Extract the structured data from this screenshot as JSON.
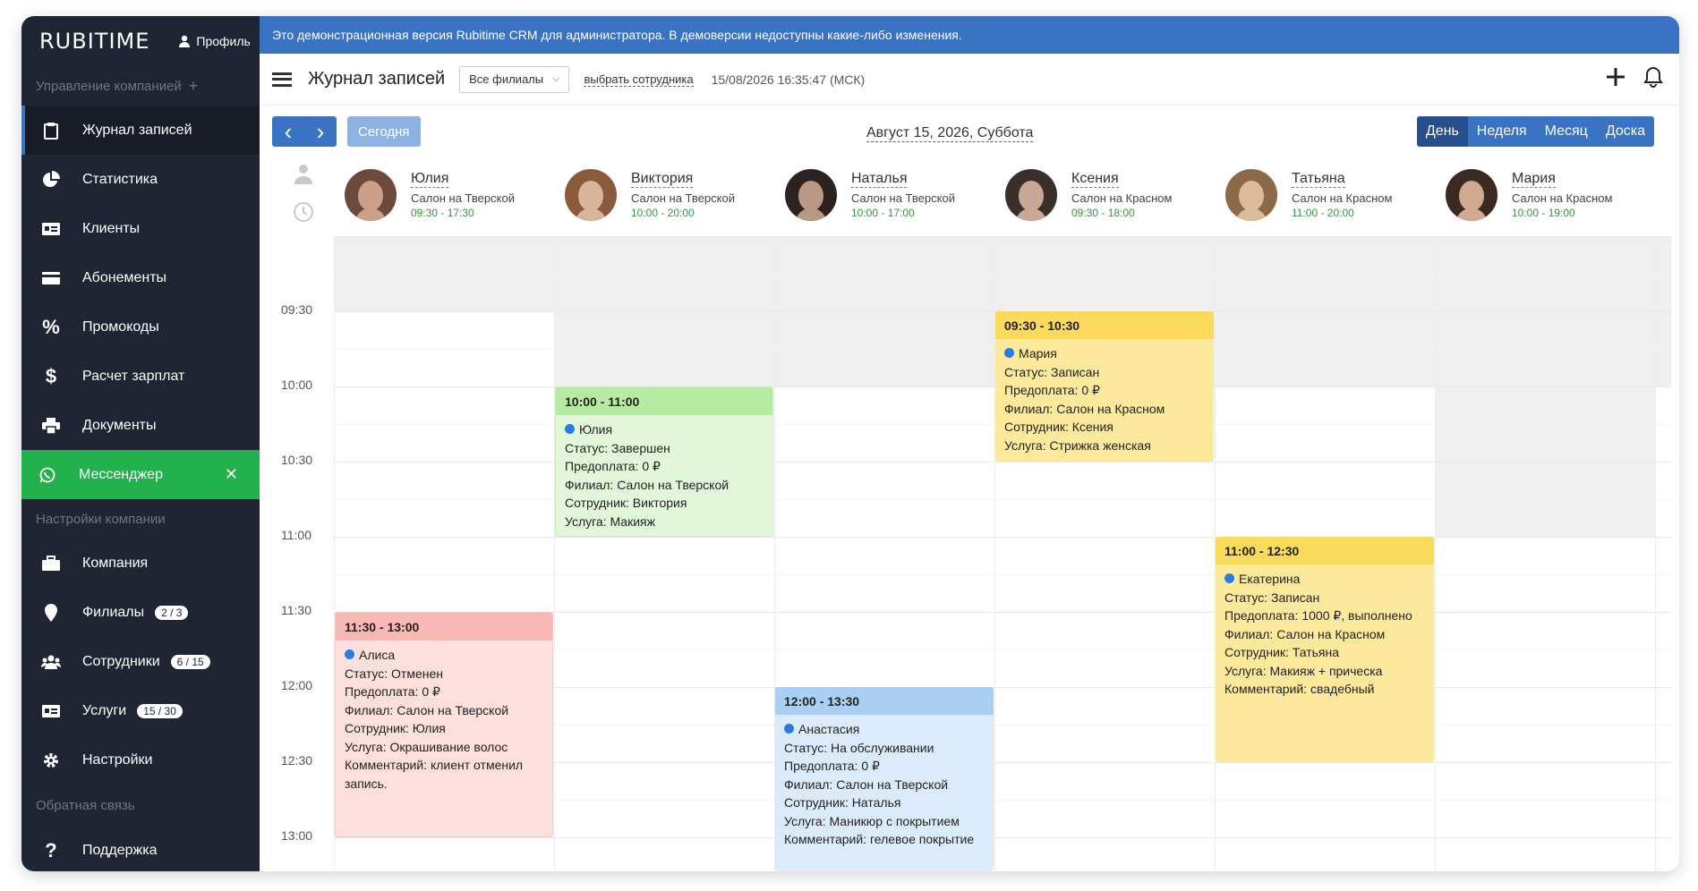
{
  "sidebar": {
    "logo": "RUBITIME",
    "profile": "Профиль",
    "section_company": "Управление компанией",
    "section_plus": "+",
    "items_top": [
      {
        "label": "Журнал записей"
      },
      {
        "label": "Статистика"
      },
      {
        "label": "Клиенты"
      },
      {
        "label": "Абонементы"
      },
      {
        "label": "Промокоды"
      },
      {
        "label": "Расчет зарплат"
      },
      {
        "label": "Документы"
      }
    ],
    "messenger": {
      "label": "Мессенджер",
      "close": "✕"
    },
    "section_settings": "Настройки компании",
    "items_settings": [
      {
        "label": "Компания",
        "badge": ""
      },
      {
        "label": "Филиалы",
        "badge": "2 / 3"
      },
      {
        "label": "Сотрудники",
        "badge": "6 / 15"
      },
      {
        "label": "Услуги",
        "badge": "15 / 30"
      },
      {
        "label": "Настройки",
        "badge": ""
      }
    ],
    "section_feedback": "Обратная связь",
    "support": "Поддержка"
  },
  "banner": "Это демонстрационная версия Rubitime CRM для администратора. В демоверсии недоступны какие-либо изменения.",
  "topbar": {
    "title": "Журнал записей",
    "branch_select": "Все филиалы",
    "employee_link": "выбрать сотрудника",
    "datetime": "15/08/2026 16:35:47 (МСК)"
  },
  "toolbar": {
    "prev": "‹",
    "next": "›",
    "today": "Сегодня",
    "date": "Август 15, 2026, Суббота",
    "views": [
      "День",
      "Неделя",
      "Месяц",
      "Доска"
    ]
  },
  "staff": [
    {
      "name": "Юлия",
      "branch": "Салон на Тверской",
      "hours": "09:30 - 17:30"
    },
    {
      "name": "Виктория",
      "branch": "Салон на Тверской",
      "hours": "10:00 - 20:00"
    },
    {
      "name": "Наталья",
      "branch": "Салон на Тверской",
      "hours": "10:00 - 17:00"
    },
    {
      "name": "Ксения",
      "branch": "Салон на Красном",
      "hours": "09:30 - 18:00"
    },
    {
      "name": "Татьяна",
      "branch": "Салон на Красном",
      "hours": "11:00 - 20:00"
    },
    {
      "name": "Мария",
      "branch": "Салон на Красном",
      "hours": "10:00 - 19:00"
    }
  ],
  "times": [
    "09:30",
    "10:00",
    "10:30",
    "11:00",
    "11:30",
    "12:00",
    "12:30",
    "13:00"
  ],
  "events": [
    {
      "time": "11:30 - 13:00",
      "client": "Алиса",
      "lines": [
        "Статус: Отменен",
        "Предоплата: 0 ₽",
        "Филиал: Салон на Тверской",
        "Сотрудник: Юлия",
        "Услуга: Окрашивание волос",
        "Комментарий: клиент отменил",
        "запись."
      ]
    },
    {
      "time": "10:00 - 11:00",
      "client": "Юлия",
      "lines": [
        "Статус: Завершен",
        "Предоплата: 0 ₽",
        "Филиал: Салон на Тверской",
        "Сотрудник: Виктория",
        "Услуга: Макияж"
      ]
    },
    {
      "time": "12:00 - 13:30",
      "client": "Анастасия",
      "lines": [
        "Статус: На обслуживании",
        "Предоплата: 0 ₽",
        "Филиал: Салон на Тверской",
        "Сотрудник: Наталья",
        "Услуга: Маникюр с покрытием",
        "Комментарий: гелевое покрытие"
      ]
    },
    {
      "time": "09:30 - 10:30",
      "client": "Мария",
      "lines": [
        "Статус: Записан",
        "Предоплата: 0 ₽",
        "Филиал: Салон на Красном",
        "Сотрудник: Ксения",
        "Услуга: Стрижка женская"
      ]
    },
    {
      "time": "11:00 - 12:30",
      "client": "Екатерина",
      "lines": [
        "Статус: Записан",
        "Предоплата: 1000 ₽, выполнено",
        "Филиал: Салон на Красном",
        "Сотрудник: Татьяна",
        "Услуга: Макияж + прическа",
        "Комментарий: свадебный"
      ]
    }
  ],
  "colors": {
    "accent": "#3b73c4",
    "sidebar": "#1f2532",
    "messenger": "#22b14c"
  }
}
